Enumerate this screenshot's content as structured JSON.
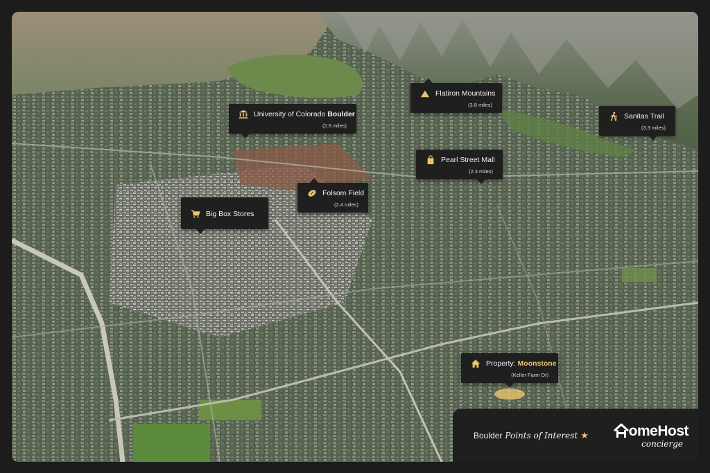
{
  "map": {
    "type": "aerial-3d",
    "city": "Boulder"
  },
  "pois": [
    {
      "id": "cu",
      "icon": "university-icon",
      "name_prefix": "University of Colorado ",
      "name_bold": "Boulder",
      "distance": "(2.6 miles)"
    },
    {
      "id": "flatirons",
      "icon": "mountain-icon",
      "name": "Flatiron Mountains",
      "distance": "(3.8 miles)"
    },
    {
      "id": "sanitas",
      "icon": "hiker-icon",
      "name": "Sanitas Trail",
      "distance": "(3.3 miles)"
    },
    {
      "id": "pearl",
      "icon": "shopping-bag-icon",
      "name": "Pearl Street Mall",
      "distance": "(2.3 miles)"
    },
    {
      "id": "folsom",
      "icon": "football-icon",
      "name": "Folsom Field",
      "distance": "(2.4 miles)"
    },
    {
      "id": "bigbox",
      "icon": "shopping-cart-icon",
      "name": "Big Box Stores",
      "distance": ""
    },
    {
      "id": "property",
      "icon": "house-icon",
      "name_prefix": "Property: ",
      "name_highlight": "Moonstone",
      "distance": "(Keller Farm Dr)"
    }
  ],
  "footer": {
    "title_plain": "Boulder",
    "title_script": "Points of Interest",
    "star": "★",
    "brand_name": "omeHost",
    "brand_sub": "concierge"
  },
  "colors": {
    "accent": "#e9c46a",
    "panel": "#1f1f1f",
    "text": "#f2f2f2"
  }
}
